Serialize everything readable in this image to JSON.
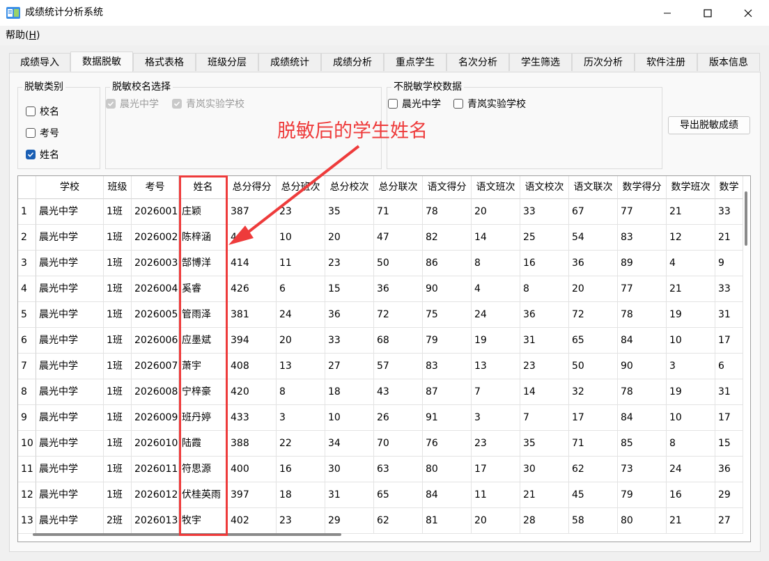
{
  "window": {
    "title": "成绩统计分析系统",
    "icon": "app-icon"
  },
  "menu": {
    "help_label": "帮助(",
    "help_key": "H",
    "help_close": ")"
  },
  "tabs": [
    "成绩导入",
    "数据脱敏",
    "格式表格",
    "班级分层",
    "成绩统计",
    "成绩分析",
    "重点学生",
    "名次分析",
    "学生筛选",
    "历次分析",
    "软件注册",
    "版本信息"
  ],
  "active_tab": "数据脱敏",
  "mask_type": {
    "title": "脱敏类别",
    "options": [
      {
        "label": "校名",
        "checked": false
      },
      {
        "label": "考号",
        "checked": false
      },
      {
        "label": "姓名",
        "checked": true
      }
    ]
  },
  "school_select": {
    "title": "脱敏校名选择",
    "options": [
      {
        "label": "晨光中学",
        "checked": true,
        "disabled": true
      },
      {
        "label": "青岚实验学校",
        "checked": true,
        "disabled": true
      }
    ]
  },
  "unmasked": {
    "title": "不脱敏学校数据",
    "options": [
      {
        "label": "晨光中学",
        "checked": false
      },
      {
        "label": "青岚实验学校",
        "checked": false
      }
    ]
  },
  "export_button": "导出脱敏成绩",
  "annotation": {
    "text": "脱敏后的学生姓名",
    "color": "#ee3b3b"
  },
  "table": {
    "columns": [
      "",
      "学校",
      "班级",
      "考号",
      "姓名",
      "总分得分",
      "总分班次",
      "总分校次",
      "总分联次",
      "语文得分",
      "语文班次",
      "语文校次",
      "语文联次",
      "数学得分",
      "数学班次",
      "数学"
    ],
    "rows": [
      [
        "1",
        "晨光中学",
        "1班",
        "2026001",
        "庄颖",
        "387",
        "23",
        "35",
        "71",
        "78",
        "20",
        "33",
        "67",
        "77",
        "21",
        "33"
      ],
      [
        "2",
        "晨光中学",
        "1班",
        "2026002",
        "陈梓涵",
        "4",
        "10",
        "20",
        "47",
        "82",
        "14",
        "25",
        "54",
        "83",
        "12",
        "21"
      ],
      [
        "3",
        "晨光中学",
        "1班",
        "2026003",
        "郜博洋",
        "414",
        "11",
        "23",
        "50",
        "86",
        "8",
        "16",
        "36",
        "89",
        "4",
        "9"
      ],
      [
        "4",
        "晨光中学",
        "1班",
        "2026004",
        "奚睿",
        "426",
        "6",
        "15",
        "36",
        "90",
        "4",
        "8",
        "20",
        "77",
        "21",
        "33"
      ],
      [
        "5",
        "晨光中学",
        "1班",
        "2026005",
        "管雨泽",
        "381",
        "24",
        "36",
        "72",
        "75",
        "24",
        "36",
        "72",
        "78",
        "19",
        "31"
      ],
      [
        "6",
        "晨光中学",
        "1班",
        "2026006",
        "应墨斌",
        "394",
        "20",
        "33",
        "68",
        "79",
        "19",
        "31",
        "65",
        "84",
        "10",
        "17"
      ],
      [
        "7",
        "晨光中学",
        "1班",
        "2026007",
        "萧宇",
        "408",
        "13",
        "27",
        "57",
        "83",
        "13",
        "23",
        "50",
        "90",
        "3",
        "6"
      ],
      [
        "8",
        "晨光中学",
        "1班",
        "2026008",
        "宁梓豪",
        "420",
        "8",
        "18",
        "43",
        "87",
        "7",
        "14",
        "32",
        "78",
        "19",
        "31"
      ],
      [
        "9",
        "晨光中学",
        "1班",
        "2026009",
        "班丹婷",
        "433",
        "3",
        "10",
        "26",
        "91",
        "3",
        "7",
        "17",
        "84",
        "10",
        "17"
      ],
      [
        "10",
        "晨光中学",
        "1班",
        "2026010",
        "陆霞",
        "388",
        "22",
        "34",
        "70",
        "76",
        "23",
        "35",
        "71",
        "85",
        "8",
        "15"
      ],
      [
        "11",
        "晨光中学",
        "1班",
        "2026011",
        "符思源",
        "400",
        "16",
        "30",
        "63",
        "80",
        "17",
        "30",
        "62",
        "73",
        "24",
        "36"
      ],
      [
        "12",
        "晨光中学",
        "1班",
        "2026012",
        "伏桂英雨",
        "397",
        "18",
        "31",
        "65",
        "84",
        "11",
        "21",
        "45",
        "79",
        "16",
        "29"
      ],
      [
        "13",
        "晨光中学",
        "2班",
        "2026013",
        "牧宇",
        "402",
        "23",
        "29",
        "62",
        "81",
        "20",
        "28",
        "58",
        "80",
        "21",
        "27"
      ]
    ]
  }
}
